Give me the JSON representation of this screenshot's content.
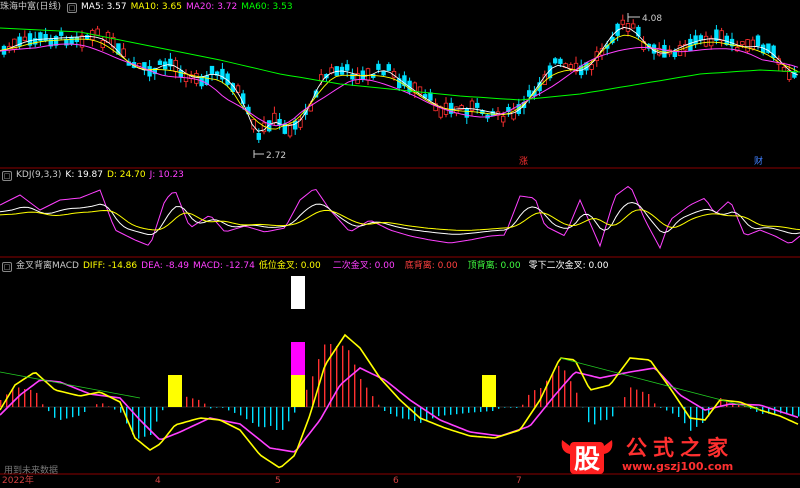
{
  "panel1": {
    "stock_name": "珠海中富(日线)",
    "ma": [
      {
        "label": "MA5: 3.57",
        "color": "#ffffff"
      },
      {
        "label": "MA10: 3.65",
        "color": "#ffff00"
      },
      {
        "label": "MA20: 3.72",
        "color": "#ff40ff"
      },
      {
        "label": "MA60: 3.53",
        "color": "#00ff00"
      }
    ],
    "high_marker": "4.08",
    "low_marker": "2.72",
    "badges": [
      {
        "text": "涨",
        "color": "#ff3030"
      },
      {
        "text": "财",
        "color": "#4080ff"
      }
    ]
  },
  "panel2": {
    "title": "KDJ(9,3,3)",
    "k": "K: 19.87",
    "d": "D: 24.70",
    "j": "J: 10.23",
    "colors": {
      "k": "#ffffff",
      "d": "#ffff00",
      "j": "#ff40ff"
    }
  },
  "panel3": {
    "title": "金叉背离MACD",
    "items": [
      {
        "label": "DIFF: -14.86",
        "color": "#ffff00"
      },
      {
        "label": "DEA: -8.49",
        "color": "#ff40ff"
      },
      {
        "label": "MACD: -12.74",
        "color": "#ff40ff"
      },
      {
        "label": "低位金叉: 0.00",
        "color": "#ffff00"
      },
      {
        "label": "二次金叉: 0.00",
        "color": "#ff40ff"
      },
      {
        "label": "底背离: 0.00",
        "color": "#ff4040"
      },
      {
        "label": "顶背离: 0.00",
        "color": "#40ff40"
      },
      {
        "label": "零下二次金叉: 0.00",
        "color": "#ffffff"
      }
    ],
    "future_note": "用到未来数据"
  },
  "x_axis": {
    "year": "2022年",
    "months": [
      "4",
      "5",
      "6",
      "7"
    ]
  },
  "watermark": {
    "logo_char": "股",
    "title": "公式之家",
    "url": "www.gszj100.com"
  },
  "colors": {
    "up": "#ff3030",
    "down": "#00e0ff",
    "grid": "#8b0000",
    "signal_yellow": "#ffff00",
    "signal_magenta": "#ff00ff",
    "signal_white": "#ffffff"
  }
}
